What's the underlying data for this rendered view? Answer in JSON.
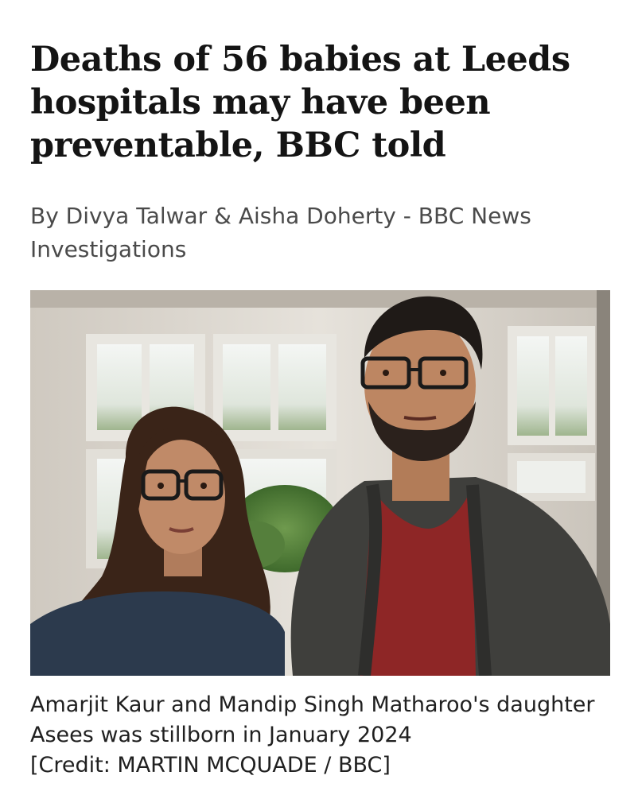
{
  "article": {
    "headline": "Deaths of 56 babies at Leeds hospitals may have been preventable, BBC told",
    "byline": "By Divya Talwar & Aisha Doherty - BBC News Investigations",
    "image": {
      "subject": "couple-portrait"
    },
    "caption": {
      "text": "Amarjit Kaur and Mandip Singh Matharoo's daughter Asees was stillborn in January 2024",
      "credit": "[Credit: MARTIN MCQUADE / BBC]"
    }
  },
  "colors": {
    "text": "#141414",
    "byline": "#4a4a4a",
    "background": "#ffffff"
  }
}
